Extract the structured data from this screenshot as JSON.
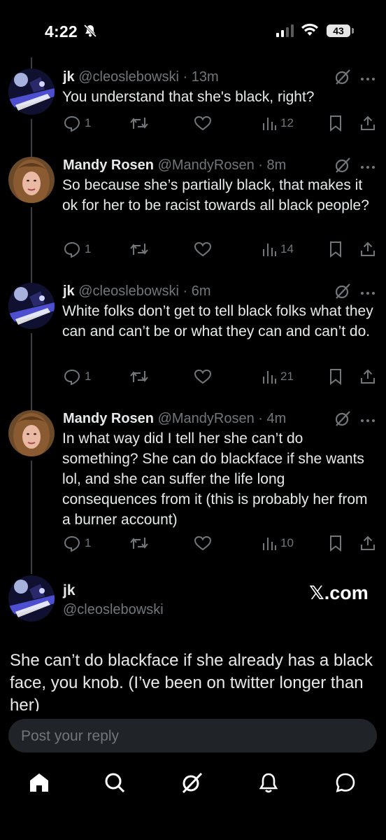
{
  "status_bar": {
    "time": "4:22",
    "battery": "43"
  },
  "tweets": [
    {
      "name": "jk",
      "handle": "@cleoslebowski",
      "time": "13m",
      "text": "You understand that she's black, right?",
      "replies": "1",
      "views": "12",
      "avatar": "night-sky-photo"
    },
    {
      "name": "Mandy Rosen",
      "handle": "@MandyRosen",
      "time": "8m",
      "text": "So because she’s partially black, that makes it ok for her to be racist towards all black people?",
      "replies": "1",
      "views": "14",
      "avatar": "woman-portrait"
    },
    {
      "name": "jk",
      "handle": "@cleoslebowski",
      "time": "6m",
      "text": "White folks don’t get to tell black folks what they can and can’t be or what they can and can’t do.",
      "replies": "1",
      "views": "21",
      "avatar": "night-sky-photo"
    },
    {
      "name": "Mandy Rosen",
      "handle": "@MandyRosen",
      "time": "4m",
      "text": "In what way did I tell her she can’t do something? She can do blackface if she wants lol, and she can suffer the life long consequences from it (this is probably her from a burner account)",
      "replies": "1",
      "views": "10",
      "avatar": "woman-portrait"
    }
  ],
  "main_tweet": {
    "name": "jk",
    "handle": "@cleoslebowski",
    "watermark": "𝕏.com",
    "text": "She can’t do blackface if she already has a black face, you knob.  (I’ve been on twitter longer than her)"
  },
  "reply_bar": {
    "placeholder": "Post your reply"
  },
  "tab_bar": {
    "items": [
      "home-icon",
      "search-icon",
      "grok-icon",
      "notifications-icon",
      "messages-icon"
    ]
  },
  "colors": {
    "background": "#000000",
    "text": "#e7e9ea",
    "secondary": "#71767b",
    "thread_line": "#3a3d41",
    "input_bg": "#202327"
  }
}
